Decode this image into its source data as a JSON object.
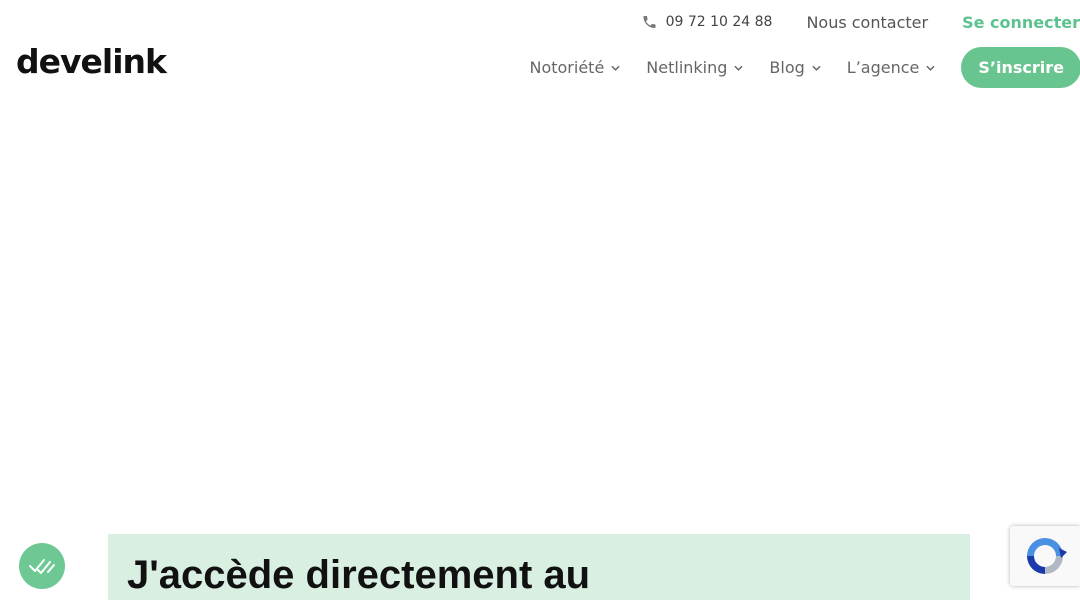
{
  "topbar": {
    "phone": "09 72 10 24 88",
    "contact": "Nous contacter",
    "login": "Se connecter"
  },
  "logo": {
    "text": "develink"
  },
  "nav": {
    "items": [
      {
        "label": "Notoriété"
      },
      {
        "label": "Netlinking"
      },
      {
        "label": "Blog"
      },
      {
        "label": "L’agence"
      }
    ],
    "signup": "S’inscrire"
  },
  "hero": {
    "title": "J'accède directement au"
  },
  "colors": {
    "accent": "#69c58f",
    "hero_bg": "#d9efe2",
    "login_text": "#5cc38e"
  },
  "icons": {
    "phone": "phone-icon",
    "chevron": "chevron-down-icon",
    "badge": "checkmarks-icon",
    "recaptcha": "recaptcha-icon"
  }
}
